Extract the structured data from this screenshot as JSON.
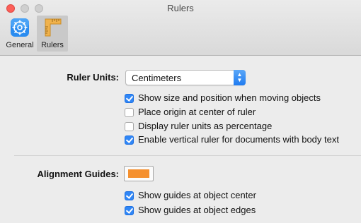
{
  "window": {
    "title": "Rulers"
  },
  "toolbar": {
    "items": [
      {
        "label": "General",
        "icon": "general-settings-icon",
        "selected": false
      },
      {
        "label": "Rulers",
        "icon": "rulers-icon",
        "selected": true
      }
    ]
  },
  "ruler_units": {
    "label": "Ruler Units:",
    "selected": "Centimeters"
  },
  "options": [
    {
      "label": "Show size and position when moving objects",
      "checked": true
    },
    {
      "label": "Place origin at center of ruler",
      "checked": false
    },
    {
      "label": "Display ruler units as percentage",
      "checked": false
    },
    {
      "label": "Enable vertical ruler for documents with body text",
      "checked": true
    }
  ],
  "alignment_guides": {
    "label": "Alignment Guides:",
    "color": "#f5902e",
    "options": [
      {
        "label": "Show guides at object center",
        "checked": true
      },
      {
        "label": "Show guides at object edges",
        "checked": true
      }
    ]
  },
  "colors": {
    "accent": "#2f86f6",
    "close": "#fc5f58"
  }
}
